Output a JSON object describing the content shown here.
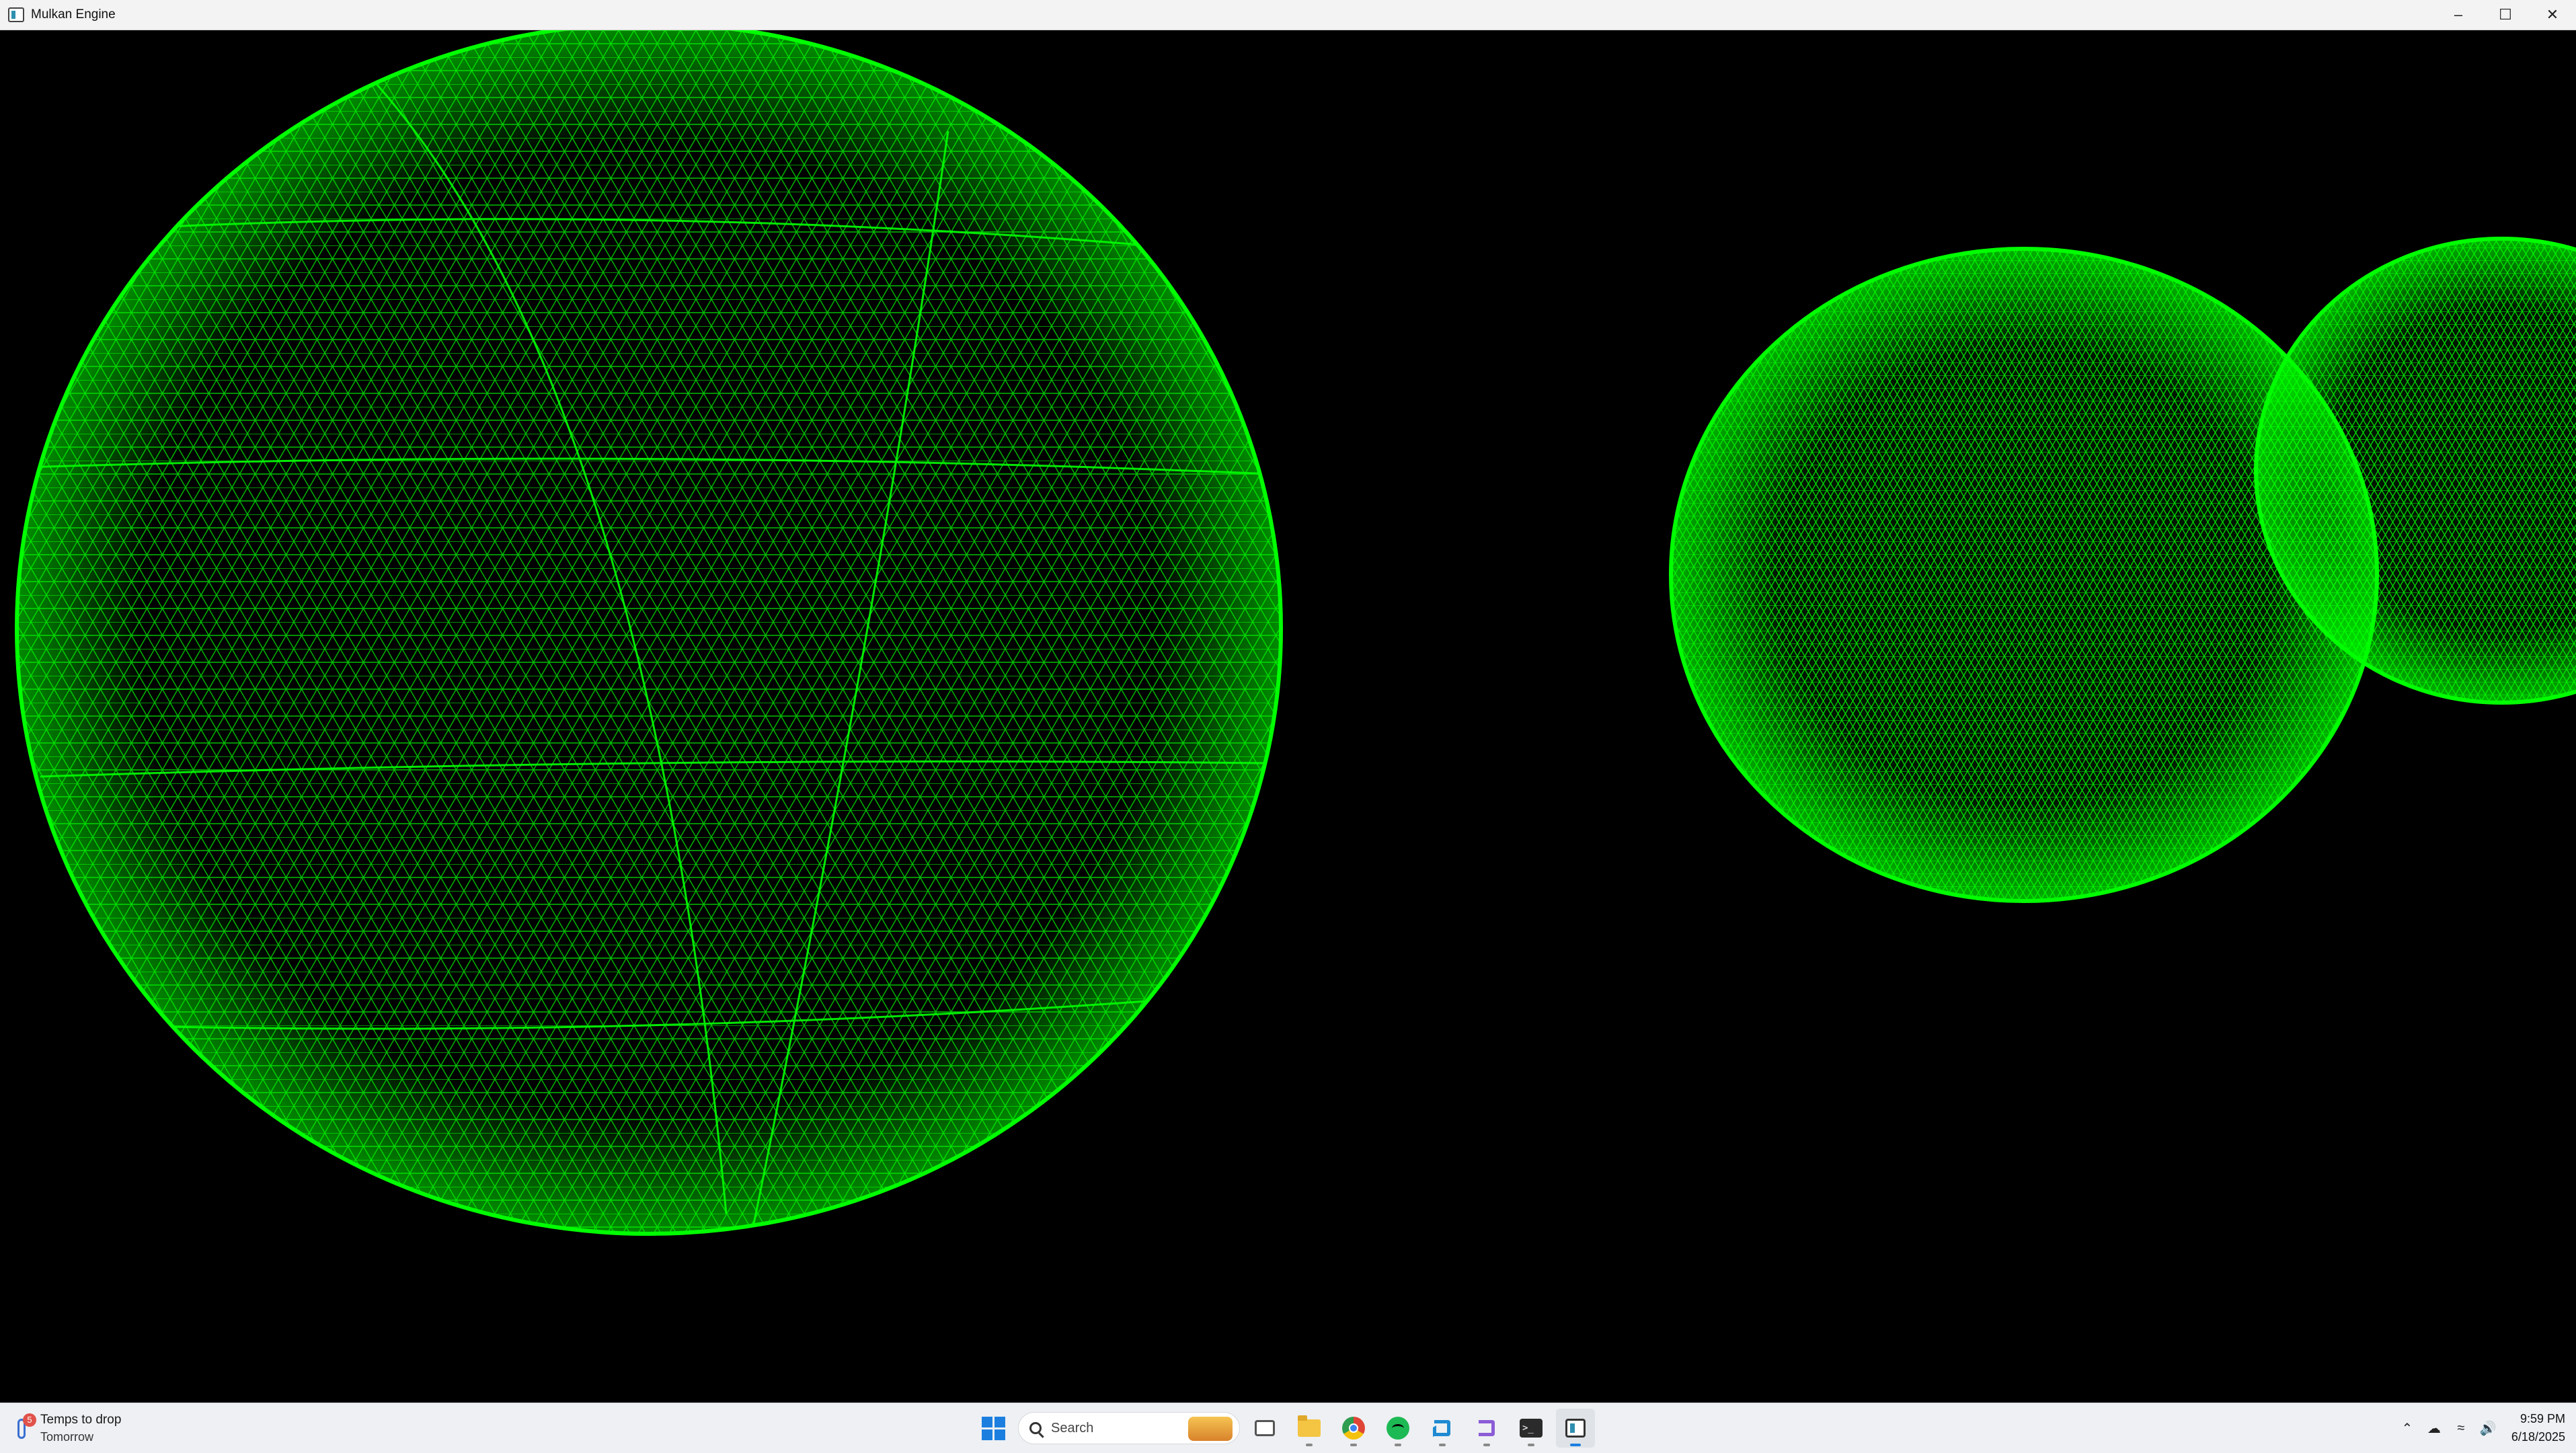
{
  "window": {
    "title": "Mulkan Engine",
    "icon": "app-window-icon",
    "controls": [
      "minimize-icon",
      "maximize-icon",
      "close-icon"
    ]
  },
  "scene": {
    "mesh_color": "#00ff00",
    "background": "#000000",
    "objects": [
      "wireframe-sphere-large",
      "wireframe-sphere-medium",
      "wireframe-sphere-partial"
    ]
  },
  "taskbar": {
    "weather": {
      "badge": "5",
      "line1": "Temps to drop",
      "line2": "Tomorrow"
    },
    "search": {
      "placeholder": "Search"
    },
    "apps": [
      "task-view",
      "file-explorer",
      "chrome",
      "spotify",
      "vscode",
      "visual-studio",
      "terminal",
      "mulkan-engine"
    ],
    "tray": {
      "time": "9:59 PM",
      "date": "6/18/2025"
    }
  }
}
